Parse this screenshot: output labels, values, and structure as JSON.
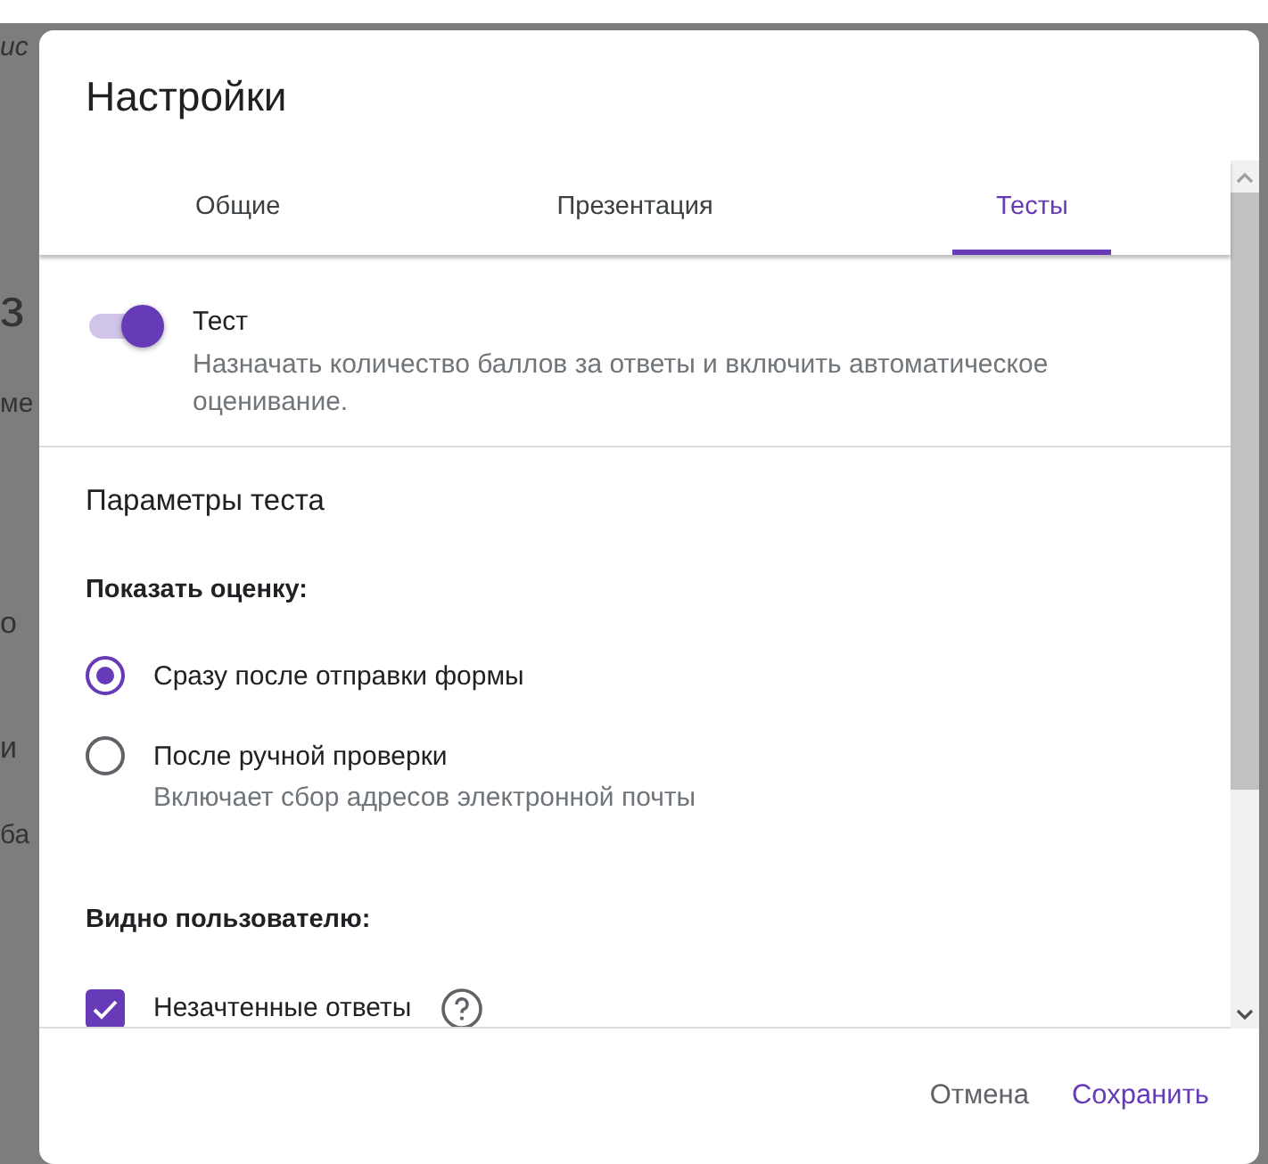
{
  "background_fragments": [
    {
      "text": "ис",
      "kind": "small"
    },
    {
      "text": "з",
      "kind": "large"
    },
    {
      "text": "ме",
      "kind": "small"
    },
    {
      "text": "о",
      "kind": "medium"
    },
    {
      "text": "и",
      "kind": "medium"
    },
    {
      "text": "ба",
      "kind": "small"
    }
  ],
  "dialog": {
    "title": "Настройки"
  },
  "tabs": [
    {
      "label": "Общие",
      "selected": false
    },
    {
      "label": "Презентация",
      "selected": false
    },
    {
      "label": "Тесты",
      "selected": true
    }
  ],
  "quiz_toggle": {
    "label": "Тест",
    "description": "Назначать количество баллов за ответы и включить автоматическое оценивание.",
    "on": true
  },
  "section_title": "Параметры теста",
  "release_grade": {
    "heading": "Показать оценку:",
    "options": [
      {
        "label": "Сразу после отправки формы",
        "selected": true
      },
      {
        "label": "После ручной проверки",
        "hint": "Включает сбор адресов электронной почты",
        "selected": false
      }
    ]
  },
  "respondent_can_see": {
    "heading": "Видно пользователю:",
    "items": [
      {
        "label": "Незачтенные ответы",
        "checked": true
      }
    ]
  },
  "buttons": [
    {
      "label": "Отмена",
      "kind": "cancel"
    },
    {
      "label": "Сохранить",
      "kind": "primary"
    }
  ]
}
